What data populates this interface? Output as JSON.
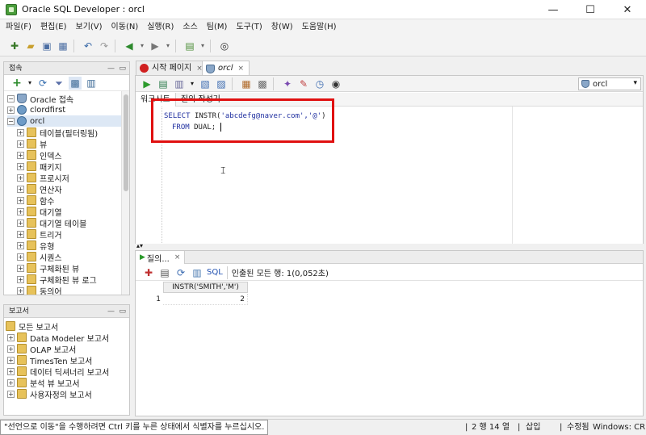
{
  "window": {
    "title": "Oracle SQL Developer : orcl",
    "minimize": "—",
    "maximize": "☐",
    "close": "✕"
  },
  "menu": [
    "파일(F)",
    "편집(E)",
    "보기(V)",
    "이동(N)",
    "실행(R)",
    "소스",
    "팀(M)",
    "도구(T)",
    "창(W)",
    "도움말(H)"
  ],
  "connections_panel": {
    "title": "접속",
    "tree": {
      "root": "Oracle 접속",
      "connections": [
        "clordfirst",
        "orcl"
      ],
      "orcl_children": [
        "테이블(필터링됨)",
        "뷰",
        "인덱스",
        "패키지",
        "프로시저",
        "연산자",
        "함수",
        "대기열",
        "대기열 테이블",
        "트리거",
        "유형",
        "시퀀스",
        "구체화된 뷰",
        "구체화된 뷰 로그",
        "동의어"
      ]
    }
  },
  "reports_panel": {
    "title": "보고서",
    "root": "모든 보고서",
    "items": [
      "Data Modeler 보고서",
      "OLAP 보고서",
      "TimesTen 보고서",
      "데이터 딕셔너리 보고서",
      "분석 뷰 보고서",
      "사용자정의 보고서"
    ]
  },
  "editor": {
    "tabs": [
      {
        "label": "시작 페이지"
      },
      {
        "label": "orcl"
      }
    ],
    "connection_selector": "orcl",
    "subtabs": [
      "워크시트",
      "질의 작성기"
    ],
    "sql_line1_kw": "SELECT",
    "sql_line1_func": "INSTR(",
    "sql_line1_str": "'abcdefg@naver.com','@'",
    "sql_line1_end": ")",
    "sql_line2_kw": "FROM",
    "sql_line2_rest": "DUAL;"
  },
  "results": {
    "tab_label": "질의...",
    "sql_label": "SQL",
    "fetched_text": "인출된 모든 행: 1(0,052초)",
    "column_header": "INSTR('SMITH','M')",
    "rows": [
      {
        "num": "1",
        "value": "2"
      }
    ]
  },
  "statusbar": {
    "message": "\"선언으로 이동\"을 수행하려면 Ctrl 키를 누른 상태에서 식별자를 누르십시오.",
    "position": "2 행 14 열",
    "insert_mode": "삽입",
    "modified": "수정됨",
    "line_ending": "Windows: CR"
  },
  "colors": {
    "highlight_box": "#e01010",
    "keyword": "#2030a0",
    "selection": "#dde8f5"
  }
}
